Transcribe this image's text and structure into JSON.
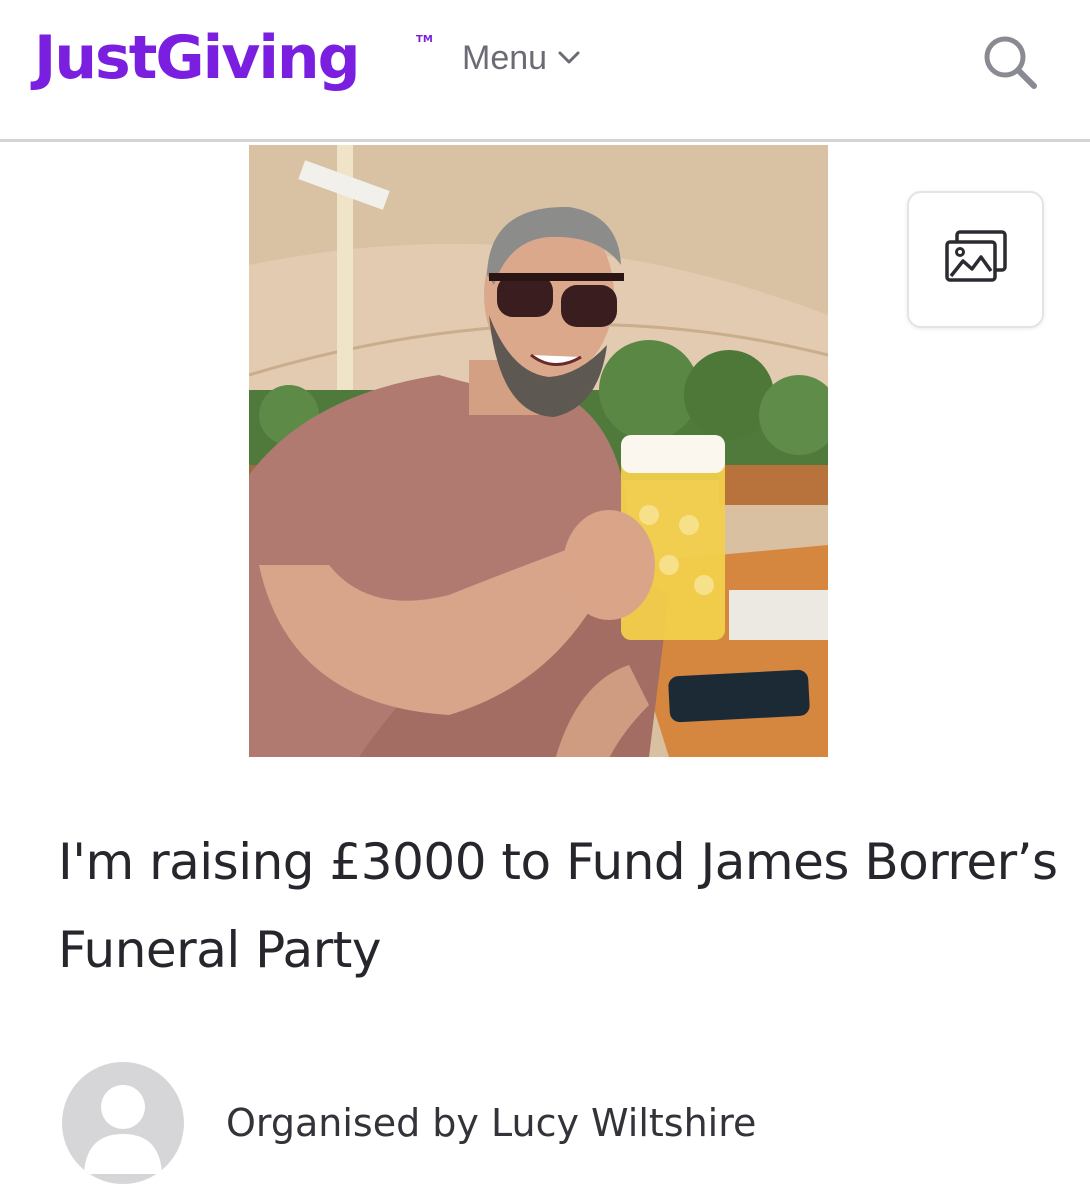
{
  "header": {
    "logo_text": "JustGiving",
    "logo_tm": "TM",
    "menu_label": "Menu",
    "brand_color": "#7a1fe0",
    "search_icon": "search-icon",
    "menu_icon": "chevron-down-icon"
  },
  "hero": {
    "gallery_icon": "image-gallery-icon"
  },
  "page": {
    "title": "I'm raising £3000 to Fund James Borrer’s Funeral Party"
  },
  "organiser": {
    "label": "Organised by Lucy Wiltshire",
    "avatar_icon": "default-avatar-icon"
  }
}
